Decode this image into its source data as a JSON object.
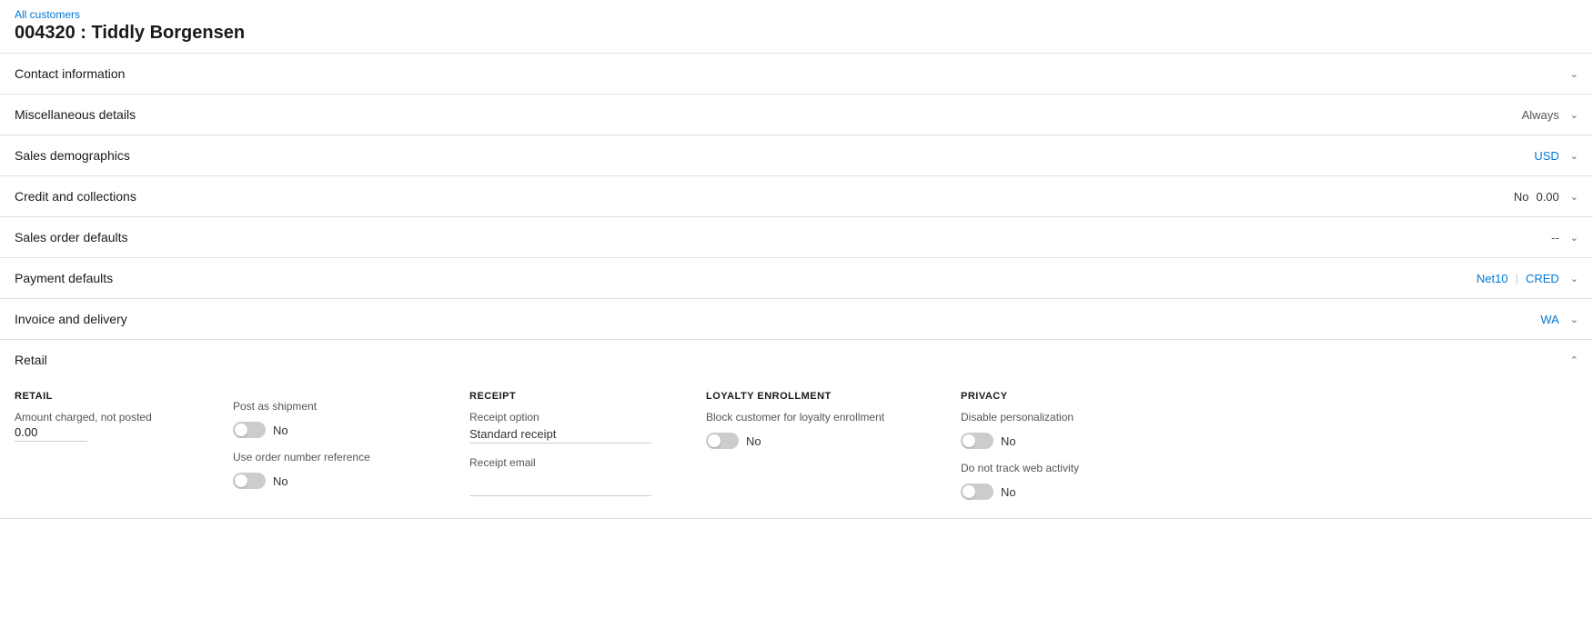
{
  "breadcrumb": {
    "label": "All customers"
  },
  "page_title": "004320 : Tiddly Borgensen",
  "sections": [
    {
      "id": "contact-information",
      "title": "Contact information",
      "badge": "",
      "badge_type": "none",
      "expanded": false
    },
    {
      "id": "miscellaneous-details",
      "title": "Miscellaneous details",
      "badge": "Always",
      "badge_type": "gray",
      "expanded": false
    },
    {
      "id": "sales-demographics",
      "title": "Sales demographics",
      "badge": "USD",
      "badge_type": "blue",
      "expanded": false
    },
    {
      "id": "credit-and-collections",
      "title": "Credit and collections",
      "badge_no": "No",
      "badge_number": "0.00",
      "badge_type": "mixed",
      "expanded": false
    },
    {
      "id": "sales-order-defaults",
      "title": "Sales order defaults",
      "badge": "--",
      "badge_type": "gray",
      "expanded": false
    },
    {
      "id": "payment-defaults",
      "title": "Payment defaults",
      "badge1": "Net10",
      "badge2": "CRED",
      "badge_type": "blue_pair",
      "expanded": false
    },
    {
      "id": "invoice-and-delivery",
      "title": "Invoice and delivery",
      "badge": "WA",
      "badge_type": "blue",
      "expanded": false
    },
    {
      "id": "retail",
      "title": "Retail",
      "badge": "",
      "badge_type": "none",
      "expanded": true
    }
  ],
  "retail": {
    "retail_col": {
      "header": "RETAIL",
      "amount_label": "Amount charged, not posted",
      "amount_value": "0.00"
    },
    "post_col": {
      "post_as_shipment_label": "Post as shipment",
      "post_as_shipment_toggle": false,
      "post_as_shipment_value": "No",
      "use_order_reference_label": "Use order number reference",
      "use_order_reference_toggle": false,
      "use_order_reference_value": "No"
    },
    "receipt_col": {
      "header": "RECEIPT",
      "receipt_option_label": "Receipt option",
      "receipt_option_value": "Standard receipt",
      "receipt_email_label": "Receipt email"
    },
    "loyalty_col": {
      "header": "LOYALTY ENROLLMENT",
      "block_label": "Block customer for loyalty enrollment",
      "block_toggle": false,
      "block_value": "No"
    },
    "privacy_col": {
      "header": "PRIVACY",
      "disable_personalization_label": "Disable personalization",
      "disable_personalization_toggle": false,
      "disable_personalization_value": "No",
      "do_not_track_label": "Do not track web activity",
      "do_not_track_toggle": false,
      "do_not_track_value": "No"
    }
  },
  "icons": {
    "chevron_down": "⌄",
    "chevron_up": "⌃"
  }
}
